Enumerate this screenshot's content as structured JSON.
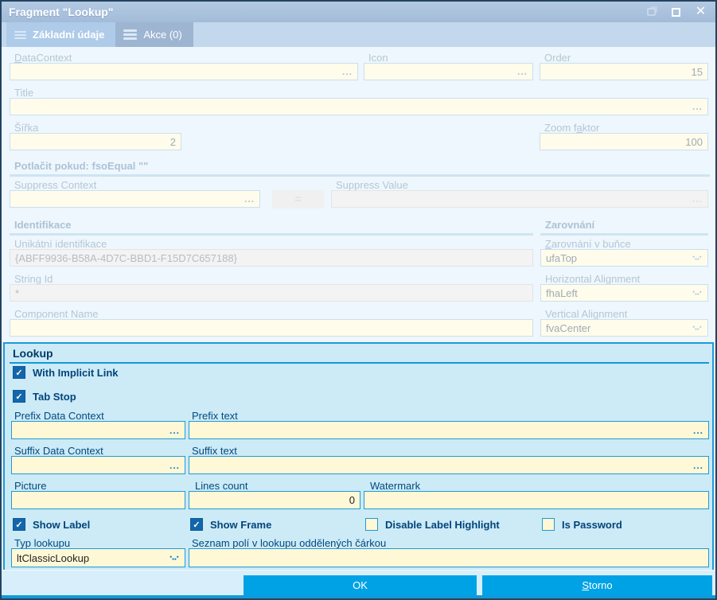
{
  "window": {
    "title": "Fragment \"Lookup\"",
    "buttons": {
      "ok": "OK",
      "storno_u": "S",
      "storno_rest": "torno"
    }
  },
  "tabs": {
    "basic": "Základní údaje",
    "actions": "Akce (0)"
  },
  "icons": {
    "ellipsis": "...",
    "equals": "=",
    "check": "✓",
    "close": "✕"
  },
  "colors": {
    "accent_blue": "#00a2e6",
    "panel_border": "#1e9bd7",
    "panel_bg": "#cdeaf7",
    "field_cream": "#fff8d6",
    "titlebar": "#a9c0db",
    "navy_text": "#004a7f"
  },
  "general": {
    "data_context": {
      "u": "D",
      "rest": "ataContext",
      "value": ""
    },
    "icon": {
      "label": "Icon",
      "value": ""
    },
    "order": {
      "label": "Order",
      "value": "15"
    },
    "title": {
      "label": "Title",
      "value": ""
    },
    "sirka": {
      "label": "Šířka",
      "value": "2"
    },
    "zoom_faktor": {
      "pre": "Zoom f",
      "u": "a",
      "rest": "ktor",
      "value": "100"
    },
    "suppress_header": "Potlačit pokud:  fsoEqual \"\"",
    "suppress_context": {
      "label": "Suppress Context",
      "value": ""
    },
    "suppress_value": {
      "label": "Suppress Value",
      "value": ""
    },
    "identifikace_header": "Identifikace",
    "unique_id": {
      "label": "Unikátní identifikace",
      "value": "{ABFF9936-B58A-4D7C-BBD1-F15D7C657188}"
    },
    "string_id": {
      "label": "String Id",
      "value": "*"
    },
    "component_name": {
      "label": "Component Name",
      "value": ""
    },
    "zarovnani_header": "Zarovnání",
    "cell_align": {
      "u": "Z",
      "rest": "arovnání v buňce",
      "value": "ufaTop"
    },
    "horizontal_align": {
      "label": "Horizontal Alignment",
      "value": "fhaLeft"
    },
    "vertical_align": {
      "label": "Vertical Alignment",
      "value": "fvaCenter"
    }
  },
  "lookup": {
    "header": "Lookup",
    "with_implicit_link": {
      "label": "With Implicit Link",
      "checked": true
    },
    "tab_stop": {
      "label": "Tab Stop",
      "checked": true
    },
    "prefix_data_context": {
      "label": "Prefix Data Context",
      "value": ""
    },
    "prefix_text": {
      "label": "Prefix text",
      "value": ""
    },
    "suffix_data_context": {
      "label": "Suffix Data Context",
      "value": ""
    },
    "suffix_text": {
      "label": "Suffix text",
      "value": ""
    },
    "picture": {
      "label": "Picture",
      "value": ""
    },
    "lines_count": {
      "label": "Lines count",
      "value": "0"
    },
    "watermark": {
      "label": "Watermark",
      "value": ""
    },
    "show_label": {
      "label": "Show Label",
      "checked": true
    },
    "show_frame": {
      "label": "Show Frame",
      "checked": true
    },
    "disable_label_highlight": {
      "label": "Disable Label Highlight",
      "checked": false
    },
    "is_password": {
      "label": "Is Password",
      "checked": false
    },
    "typ_lookupu": {
      "label": "Typ lookupu",
      "value": "ltClassicLookup"
    },
    "seznam": {
      "label": "Seznam polí v lookupu oddělených čárkou",
      "value": ""
    }
  }
}
